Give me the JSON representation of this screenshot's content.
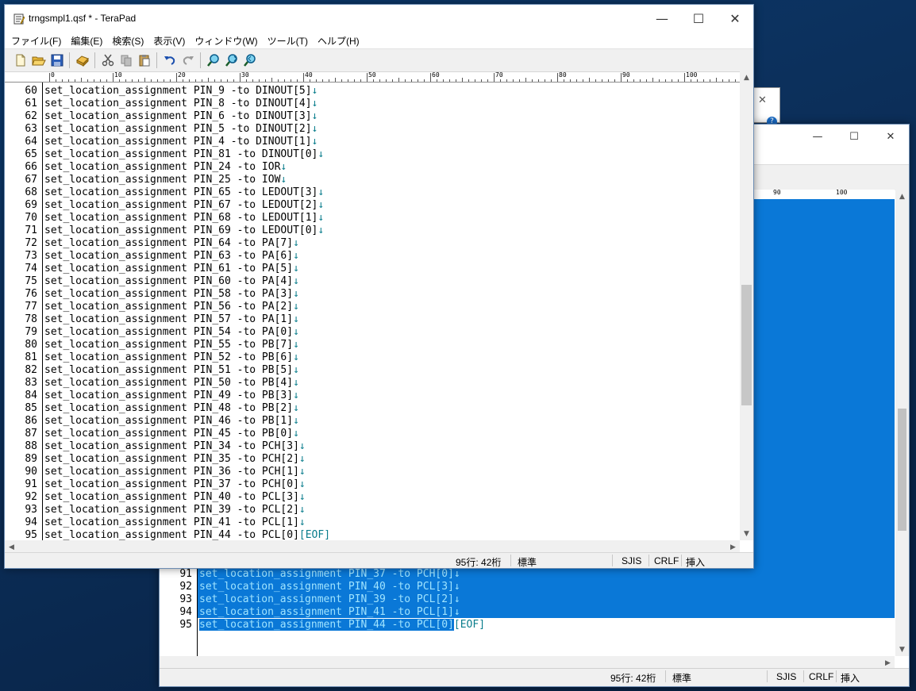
{
  "main_window": {
    "title": "trngsmpl1.qsf * - TeraPad",
    "caption": {
      "minimize": "—",
      "maximize": "☐",
      "close": "✕"
    },
    "menu": [
      "ファイル(F)",
      "編集(E)",
      "検索(S)",
      "表示(V)",
      "ウィンドウ(W)",
      "ツール(T)",
      "ヘルプ(H)"
    ],
    "toolbar_icons": [
      "new-file-icon",
      "open-folder-icon",
      "save-icon",
      "print-icon",
      "cut-icon",
      "copy-icon",
      "paste-icon",
      "undo-icon",
      "redo-icon",
      "find-icon",
      "find-next-icon",
      "find-prev-icon"
    ],
    "ruler_labels": [
      "0",
      "10",
      "20",
      "30",
      "40",
      "50",
      "60",
      "70",
      "80",
      "90",
      "100"
    ],
    "lines": [
      {
        "n": "60",
        "t": "set_location_assignment PIN_9 -to DINOUT[5]"
      },
      {
        "n": "61",
        "t": "set_location_assignment PIN_8 -to DINOUT[4]"
      },
      {
        "n": "62",
        "t": "set_location_assignment PIN_6 -to DINOUT[3]"
      },
      {
        "n": "63",
        "t": "set_location_assignment PIN_5 -to DINOUT[2]"
      },
      {
        "n": "64",
        "t": "set_location_assignment PIN_4 -to DINOUT[1]"
      },
      {
        "n": "65",
        "t": "set_location_assignment PIN_81 -to DINOUT[0]"
      },
      {
        "n": "66",
        "t": "set_location_assignment PIN_24 -to IOR"
      },
      {
        "n": "67",
        "t": "set_location_assignment PIN_25 -to IOW"
      },
      {
        "n": "68",
        "t": "set_location_assignment PIN_65 -to LEDOUT[3]"
      },
      {
        "n": "69",
        "t": "set_location_assignment PIN_67 -to LEDOUT[2]"
      },
      {
        "n": "70",
        "t": "set_location_assignment PIN_68 -to LEDOUT[1]"
      },
      {
        "n": "71",
        "t": "set_location_assignment PIN_69 -to LEDOUT[0]"
      },
      {
        "n": "72",
        "t": "set_location_assignment PIN_64 -to PA[7]"
      },
      {
        "n": "73",
        "t": "set_location_assignment PIN_63 -to PA[6]"
      },
      {
        "n": "74",
        "t": "set_location_assignment PIN_61 -to PA[5]"
      },
      {
        "n": "75",
        "t": "set_location_assignment PIN_60 -to PA[4]"
      },
      {
        "n": "76",
        "t": "set_location_assignment PIN_58 -to PA[3]"
      },
      {
        "n": "77",
        "t": "set_location_assignment PIN_56 -to PA[2]"
      },
      {
        "n": "78",
        "t": "set_location_assignment PIN_57 -to PA[1]"
      },
      {
        "n": "79",
        "t": "set_location_assignment PIN_54 -to PA[0]"
      },
      {
        "n": "80",
        "t": "set_location_assignment PIN_55 -to PB[7]"
      },
      {
        "n": "81",
        "t": "set_location_assignment PIN_52 -to PB[6]"
      },
      {
        "n": "82",
        "t": "set_location_assignment PIN_51 -to PB[5]"
      },
      {
        "n": "83",
        "t": "set_location_assignment PIN_50 -to PB[4]"
      },
      {
        "n": "84",
        "t": "set_location_assignment PIN_49 -to PB[3]"
      },
      {
        "n": "85",
        "t": "set_location_assignment PIN_48 -to PB[2]"
      },
      {
        "n": "86",
        "t": "set_location_assignment PIN_46 -to PB[1]"
      },
      {
        "n": "87",
        "t": "set_location_assignment PIN_45 -to PB[0]"
      },
      {
        "n": "88",
        "t": "set_location_assignment PIN_34 -to PCH[3]"
      },
      {
        "n": "89",
        "t": "set_location_assignment PIN_35 -to PCH[2]"
      },
      {
        "n": "90",
        "t": "set_location_assignment PIN_36 -to PCH[1]"
      },
      {
        "n": "91",
        "t": "set_location_assignment PIN_37 -to PCH[0]"
      },
      {
        "n": "92",
        "t": "set_location_assignment PIN_40 -to PCL[3]"
      },
      {
        "n": "93",
        "t": "set_location_assignment PIN_39 -to PCL[2]"
      },
      {
        "n": "94",
        "t": "set_location_assignment PIN_41 -to PCL[1]"
      },
      {
        "n": "95",
        "t": "set_location_assignment PIN_44 -to PCL[0]",
        "eof": "[EOF]"
      }
    ],
    "eol_mark": "↓",
    "status": {
      "position": "95行: 42桁",
      "mode": "標準",
      "encoding": "SJIS",
      "newline": "CRLF",
      "insert": "挿入"
    }
  },
  "back_window": {
    "caption": {
      "minimize": "—",
      "maximize": "☐",
      "close": "✕"
    },
    "ruler_labels": [
      "90",
      "100"
    ],
    "lines": [
      {
        "n": "91",
        "t": "set_location_assignment PIN_37 -to PCH[0]"
      },
      {
        "n": "92",
        "t": "set_location_assignment PIN_40 -to PCL[3]"
      },
      {
        "n": "93",
        "t": "set_location_assignment PIN_39 -to PCL[2]"
      },
      {
        "n": "94",
        "t": "set_location_assignment PIN_41 -to PCL[1]"
      },
      {
        "n": "95",
        "t": "set_location_assignment PIN_44 -to PCL[0]",
        "eof": "[EOF]"
      }
    ],
    "status": {
      "position": "95行: 42桁",
      "mode": "標準",
      "encoding": "SJIS",
      "newline": "CRLF",
      "insert": "挿入"
    }
  },
  "dialog_fragment": {
    "close": "✕",
    "help": "?"
  },
  "colors": {
    "selection": "#0a78d7",
    "eol": "#0a7d8c",
    "desktop": "#0c2f5a"
  }
}
